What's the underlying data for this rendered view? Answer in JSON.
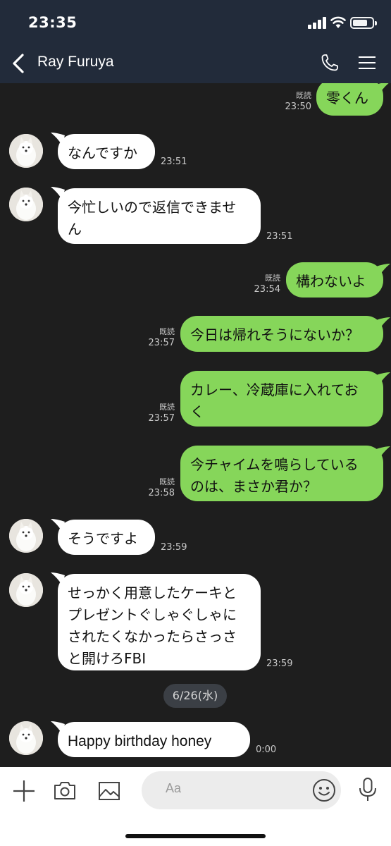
{
  "status_bar": {
    "time": "23:35"
  },
  "header": {
    "contact_name": "Ray Furuya"
  },
  "messages": [
    {
      "dir": "out",
      "text": "零くん",
      "read": "既読",
      "time": "23:50"
    },
    {
      "dir": "in",
      "text": "なんですか",
      "time": "23:51"
    },
    {
      "dir": "in",
      "text": "今忙しいので返信できませ\nん",
      "time": "23:51"
    },
    {
      "dir": "out",
      "text": "構わないよ",
      "read": "既読",
      "time": "23:54"
    },
    {
      "dir": "out",
      "text": "今日は帰れそうにないか？",
      "read": "既読",
      "time": "23:57"
    },
    {
      "dir": "out",
      "text": "カレー、冷蔵庫に入れてお\nく",
      "read": "既読",
      "time": "23:57"
    },
    {
      "dir": "out",
      "text": "今チャイムを鳴らしている\nのは、まさか君か？",
      "read": "既読",
      "time": "23:58"
    },
    {
      "dir": "in",
      "text": "そうですよ",
      "time": "23:59"
    },
    {
      "dir": "in",
      "text": "せっかく用意したケーキと\nプレゼントぐしゃぐしゃに\nされたくなかったらさっさ\nと開けろFBI",
      "time": "23:59"
    },
    {
      "dir": "in",
      "text": "Happy  birthday honey",
      "time": "0:00"
    }
  ],
  "date_separator": "6/26(水)",
  "input": {
    "placeholder": "Aa"
  },
  "colors": {
    "header_bg": "#222b3a",
    "chat_bg": "#1e1e1e",
    "outgoing_bubble": "#86d65a",
    "incoming_bubble": "#ffffff"
  },
  "icons": [
    "back-icon",
    "phone-icon",
    "menu-icon",
    "plus-icon",
    "camera-icon",
    "image-icon",
    "emoji-icon",
    "mic-icon"
  ]
}
